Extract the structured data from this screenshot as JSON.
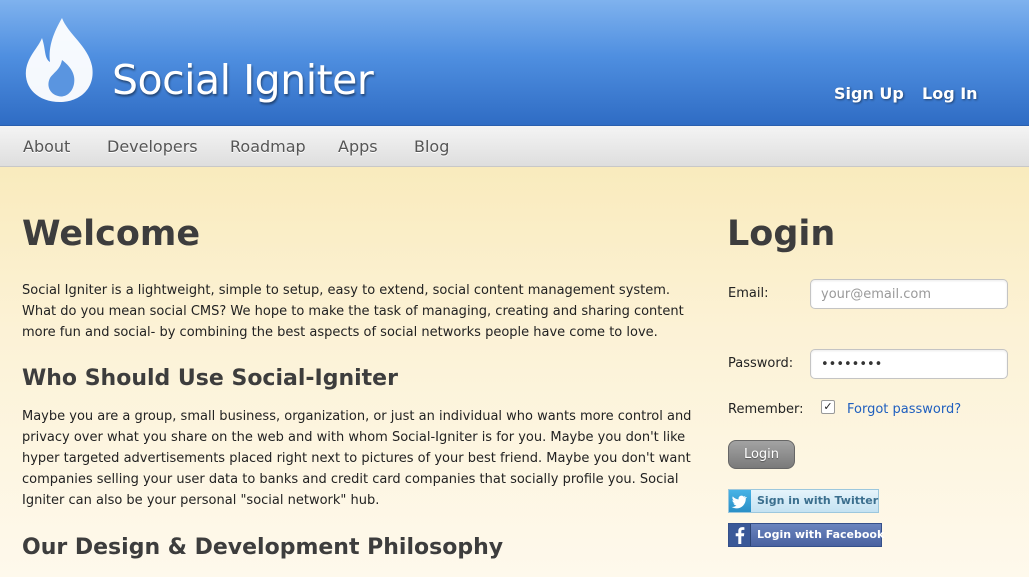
{
  "header": {
    "site_name": "Social Igniter",
    "sign_up": "Sign Up",
    "log_in": "Log In",
    "logo_icon": "flame-icon"
  },
  "nav": {
    "items": [
      {
        "label": "About"
      },
      {
        "label": "Developers"
      },
      {
        "label": "Roadmap"
      },
      {
        "label": "Apps"
      },
      {
        "label": "Blog"
      }
    ]
  },
  "main": {
    "title": "Welcome",
    "intro": "Social Igniter is a lightweight, simple to setup, easy to extend, social content management system. What do you mean social CMS? We hope to make the task of managing, creating and sharing content more fun and social- by combining the best aspects of social networks people have come to love.",
    "section1_title": "Who Should Use Social-Igniter",
    "section1_body": "Maybe you are a group, small business, organization, or just an individual who wants more control and privacy over what you share on the web and with whom Social-Igniter is for you. Maybe you don't like hyper targeted advertisements placed right next to pictures of your best friend. Maybe you don't want companies selling your user data to banks and credit card companies that socially profile you. Social Igniter can also be your personal \"social network\" hub.",
    "section2_title": "Our Design & Development Philosophy"
  },
  "login": {
    "title": "Login",
    "email_label": "Email:",
    "email_placeholder": "your@email.com",
    "password_label": "Password:",
    "password_value": "••••••••",
    "remember_label": "Remember:",
    "remember_checked": "✓",
    "forgot_password": "Forgot password?",
    "login_button": "Login",
    "twitter_button": "Sign in with Twitter",
    "facebook_button": "Login with Facebook"
  },
  "colors": {
    "header_blue": "#4f8fe0",
    "link_blue": "#1f5fbf",
    "content_bg": "#fdf6de"
  }
}
